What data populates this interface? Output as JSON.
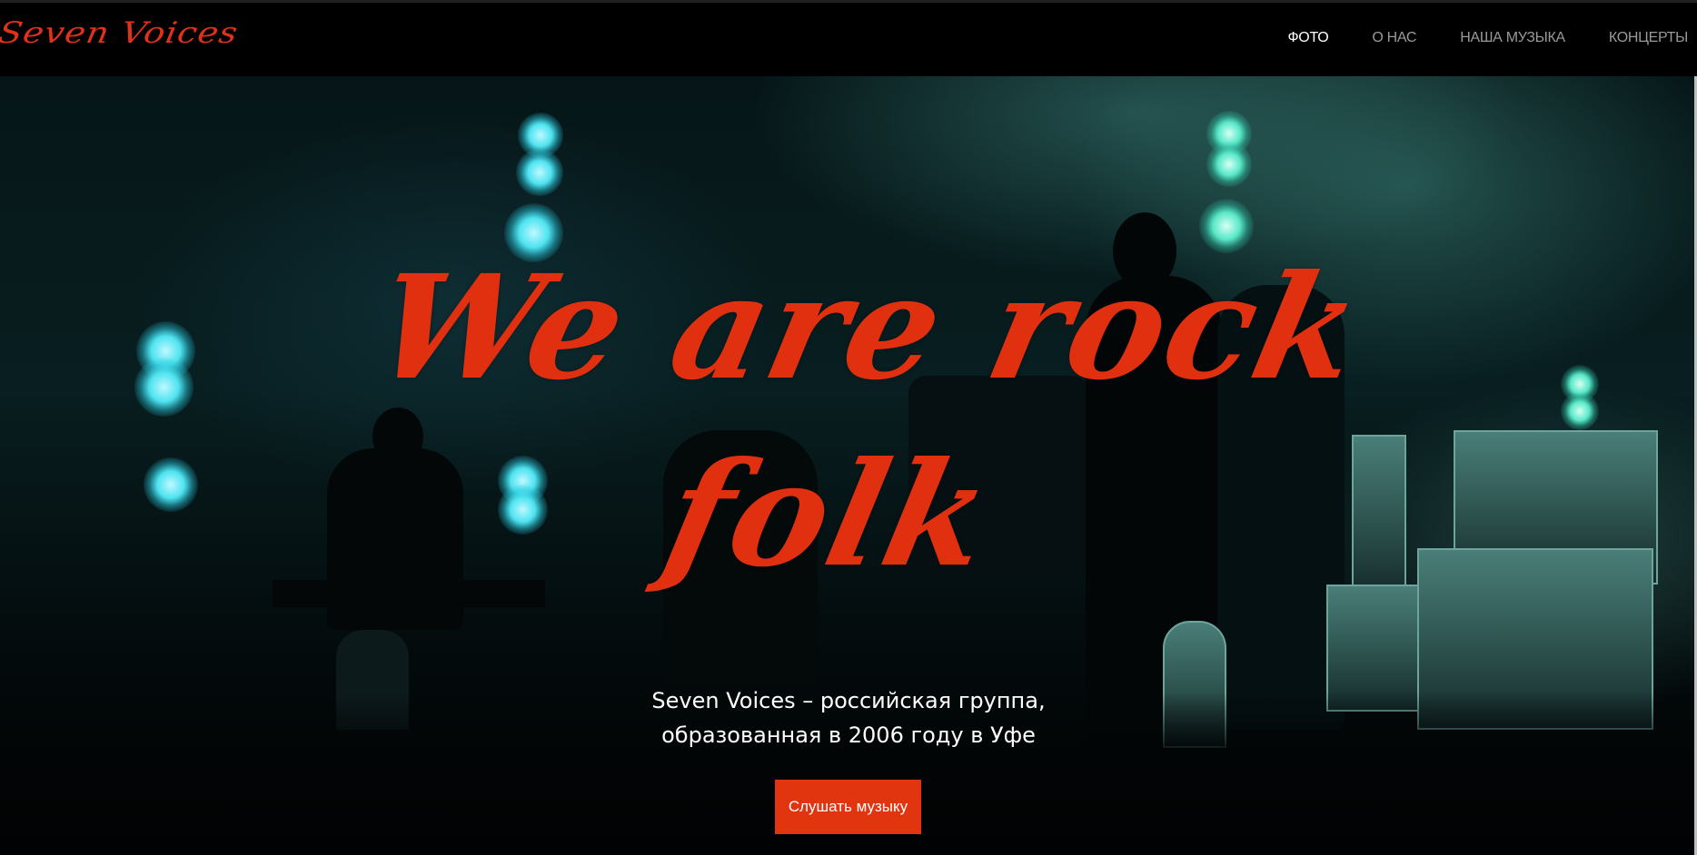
{
  "header": {
    "logo": "Seven Voices",
    "nav": [
      {
        "label": "ФОТО",
        "active": true
      },
      {
        "label": "О НАС",
        "active": false
      },
      {
        "label": "НАША МУЗЫКА",
        "active": false
      },
      {
        "label": "КОНЦЕРТЫ",
        "active": false
      }
    ]
  },
  "hero": {
    "headline_line1": "We are rock",
    "headline_line2": "folk",
    "subtitle_line1": "Seven Voices – российская группа,",
    "subtitle_line2": "образованная в 2006 году в Уфе",
    "cta_label": "Слушать музыку",
    "background_image": "concert-stage-photo"
  },
  "colors": {
    "accent": "#e0350f",
    "header_bg": "#000000",
    "nav_text": "#9a9a9a",
    "nav_active": "#ffffff",
    "stage_tint": "#2a9e9a"
  }
}
